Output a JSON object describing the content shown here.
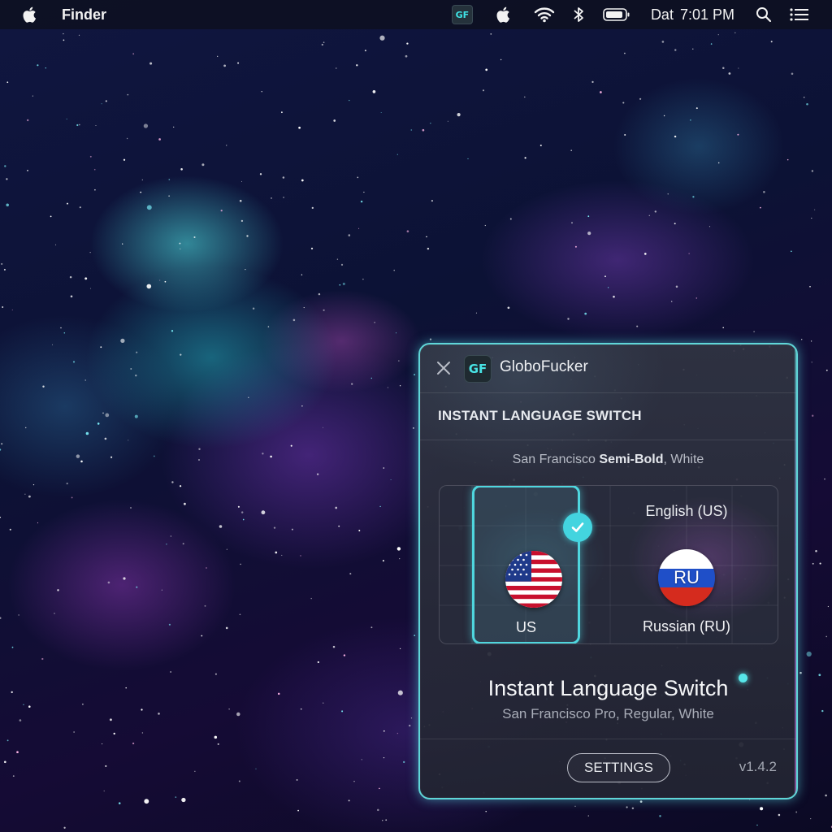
{
  "menubar": {
    "app_name": "Finder",
    "clock_day": "Dat",
    "clock_time": "7:01 PM",
    "app_badge": "GF",
    "icons": [
      "apple-icon",
      "gf-app-icon",
      "apple-icon",
      "wifi-icon",
      "bluetooth-icon",
      "battery-icon",
      "search-icon",
      "control-center-icon"
    ]
  },
  "panel": {
    "badge": "GF",
    "app_name": "GloboFucker",
    "section_title": "INSTANT LANGUAGE SWITCH",
    "font_caption_regular": "San Francisco",
    "font_caption_bold": "Semi-Bold",
    "font_caption_suffix": ", White",
    "languages": [
      {
        "code": "US",
        "label": "US",
        "selected": true
      },
      {
        "code": "RU",
        "label": "Russian (RU)",
        "hint": "English (US)",
        "selected": false
      }
    ],
    "headline": "Instant Language Switch",
    "headline_caption": "San Francisco Pro, Regular, White",
    "settings_label": "SETTINGS",
    "version": "v1.4.2"
  },
  "colors": {
    "accent": "#4fd6de",
    "panel_bg": "#2c2f40",
    "menubar_bg": "#0e101e"
  }
}
